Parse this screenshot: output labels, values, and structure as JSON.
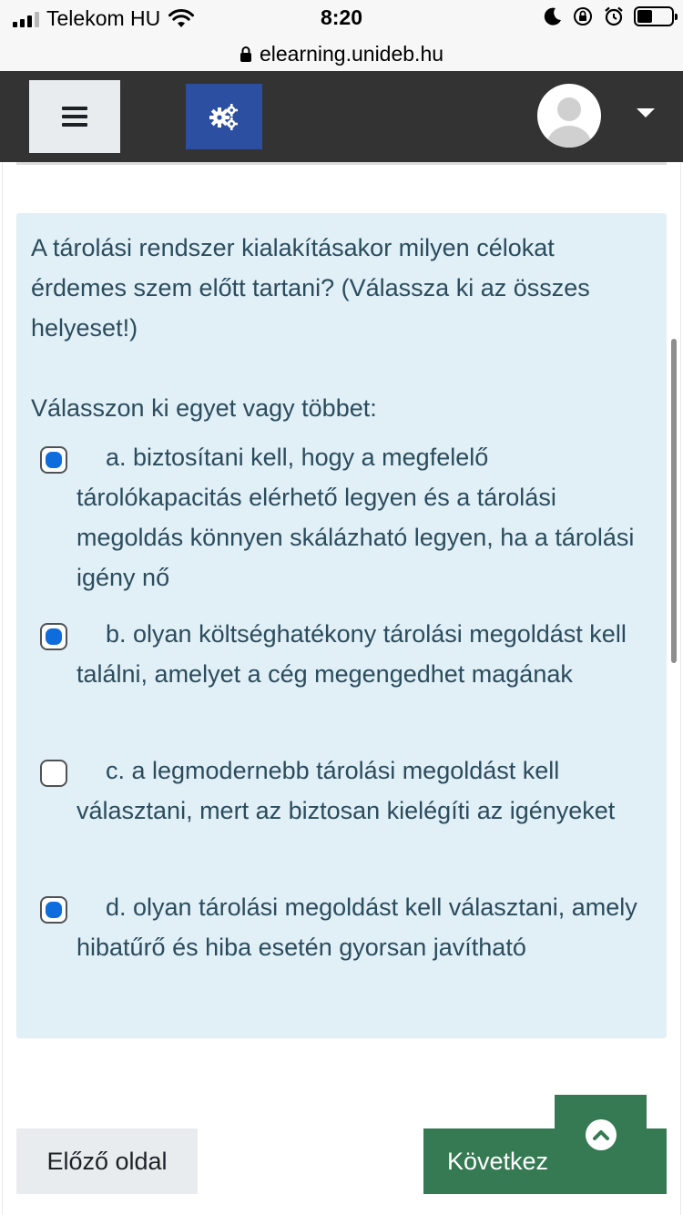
{
  "status_bar": {
    "carrier": "Telekom HU",
    "time": "8:20",
    "url": "elearning.unideb.hu"
  },
  "navbar": {
    "menu_icon": "hamburger-icon",
    "settings_icon": "gears-icon",
    "avatar_icon": "user-avatar",
    "dropdown_icon": "caret-down-icon"
  },
  "question": {
    "text": "A tárolási rendszer kialakításakor milyen célokat érdemes szem előtt tartani? (Válassza ki az összes helyeset!)",
    "prompt": "Válasszon ki egyet vagy többet:",
    "options": [
      {
        "label": "a. biztosítani kell, hogy a megfelelő tárolókapacitás elérhető legyen és a tárolási megoldás könnyen skálázható legyen, ha a tárolási igény nő",
        "checked": true
      },
      {
        "label": "b. olyan költséghatékony tárolási megoldást kell találni, amelyet a cég megengedhet magának",
        "checked": true
      },
      {
        "label": "c. a legmodernebb tárolási megoldást kell választani, mert az biztosan kielégíti az igényeket",
        "checked": false
      },
      {
        "label": "d. olyan tárolási megoldást kell választani, amely hibatűrő és hiba esetén gyorsan javítható",
        "checked": true
      }
    ]
  },
  "footer": {
    "prev_label": "Előző oldal",
    "next_label": "Következ",
    "back_to_top_icon": "chevron-up-icon"
  },
  "colors": {
    "navbar": "#333333",
    "settings_button": "#2d4fa1",
    "question_bg": "#e1eff7",
    "question_text": "#2b4c5c",
    "checkbox_accent": "#0f6cdc",
    "next_button": "#357a52"
  }
}
